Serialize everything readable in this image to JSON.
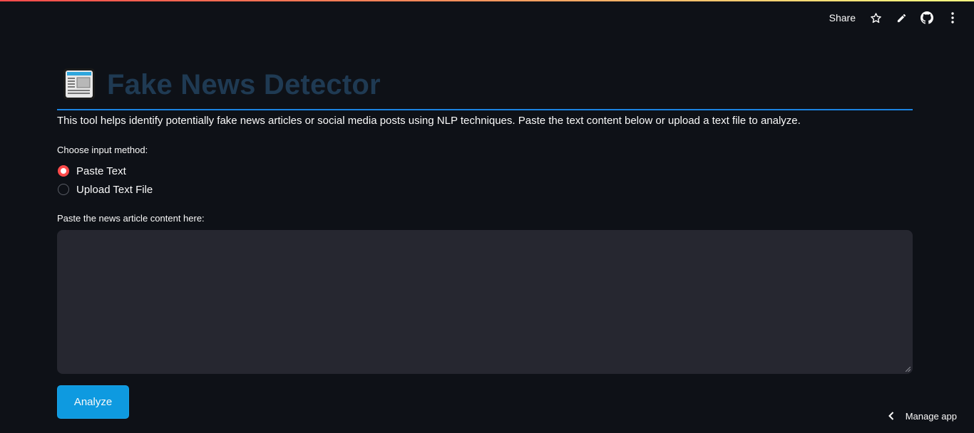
{
  "header": {
    "share_label": "Share",
    "icons": [
      "star-icon",
      "pencil-icon",
      "github-icon",
      "more-vertical-icon"
    ]
  },
  "app": {
    "title_icon": "newspaper-icon",
    "title": "Fake News Detector",
    "description": "This tool helps identify potentially fake news articles or social media posts using NLP techniques. Paste the text content below or upload a text file to analyze.",
    "input_method": {
      "label": "Choose input method:",
      "options": [
        {
          "label": "Paste Text",
          "selected": true
        },
        {
          "label": "Upload Text File",
          "selected": false
        }
      ]
    },
    "textarea": {
      "label": "Paste the news article content here:",
      "value": ""
    },
    "analyze_label": "Analyze"
  },
  "footer": {
    "manage_app_label": "Manage app"
  },
  "colors": {
    "background": "#0e1117",
    "title": "#1f3a53",
    "accent": "#ff4b4b",
    "button": "#0e9ae0",
    "rule": "#1c83e1",
    "input_bg": "#262730"
  }
}
